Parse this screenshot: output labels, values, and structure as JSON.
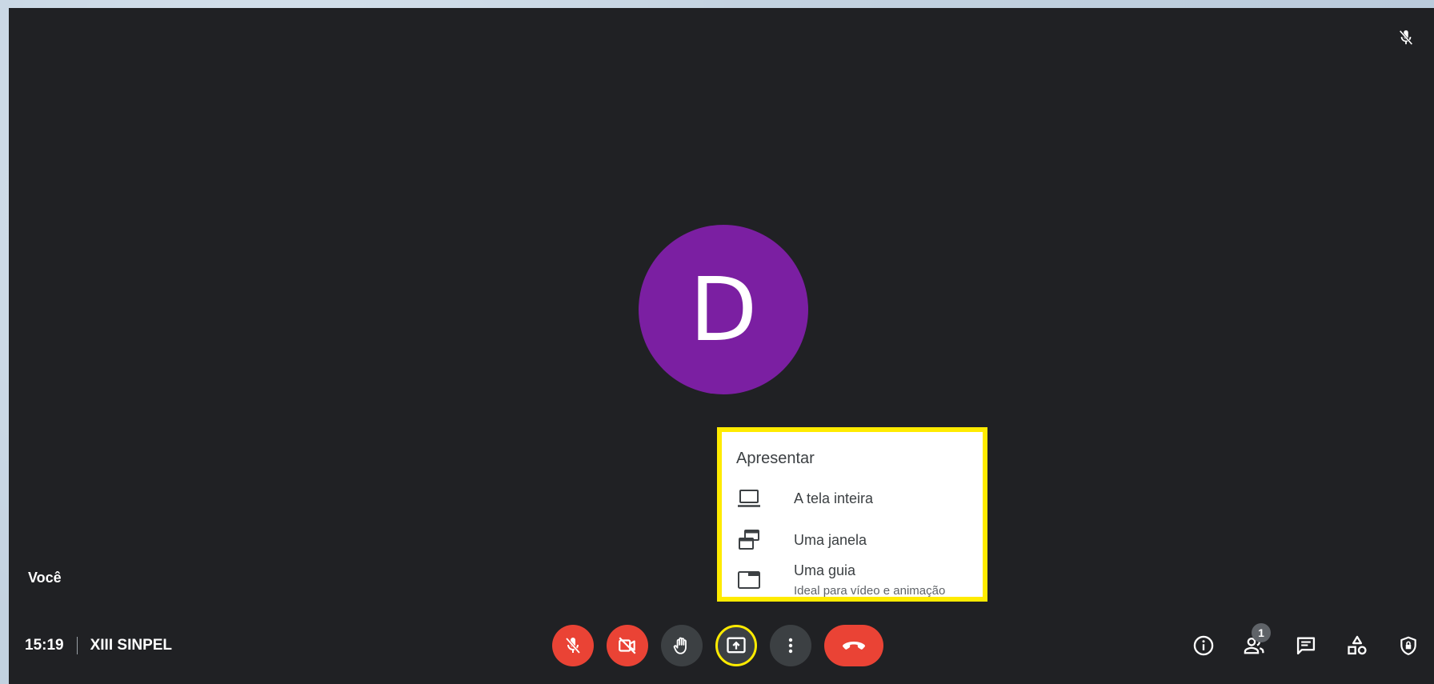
{
  "participant": {
    "initial": "D",
    "self_label": "Você",
    "avatar_color": "#7b1fa2"
  },
  "meeting": {
    "time": "15:19",
    "name": "XIII SINPEL"
  },
  "controls": {
    "mic": "mic-off-icon",
    "camera": "camera-off-icon",
    "raise_hand": "raise-hand-icon",
    "present": "present-screen-icon",
    "more": "more-vert-icon",
    "end": "call-end-icon"
  },
  "right_controls": {
    "people_badge": "1"
  },
  "present_menu": {
    "title": "Apresentar",
    "items": [
      {
        "label": "A tela inteira",
        "icon": "laptop-icon"
      },
      {
        "label": "Uma janela",
        "icon": "window-icon"
      },
      {
        "label": "Uma guia",
        "sublabel": "Ideal para vídeo e animação",
        "icon": "tab-icon"
      }
    ]
  },
  "colors": {
    "background": "#202124",
    "danger": "#ea4335",
    "control": "#3c4043",
    "highlight": "#ffeb00"
  }
}
